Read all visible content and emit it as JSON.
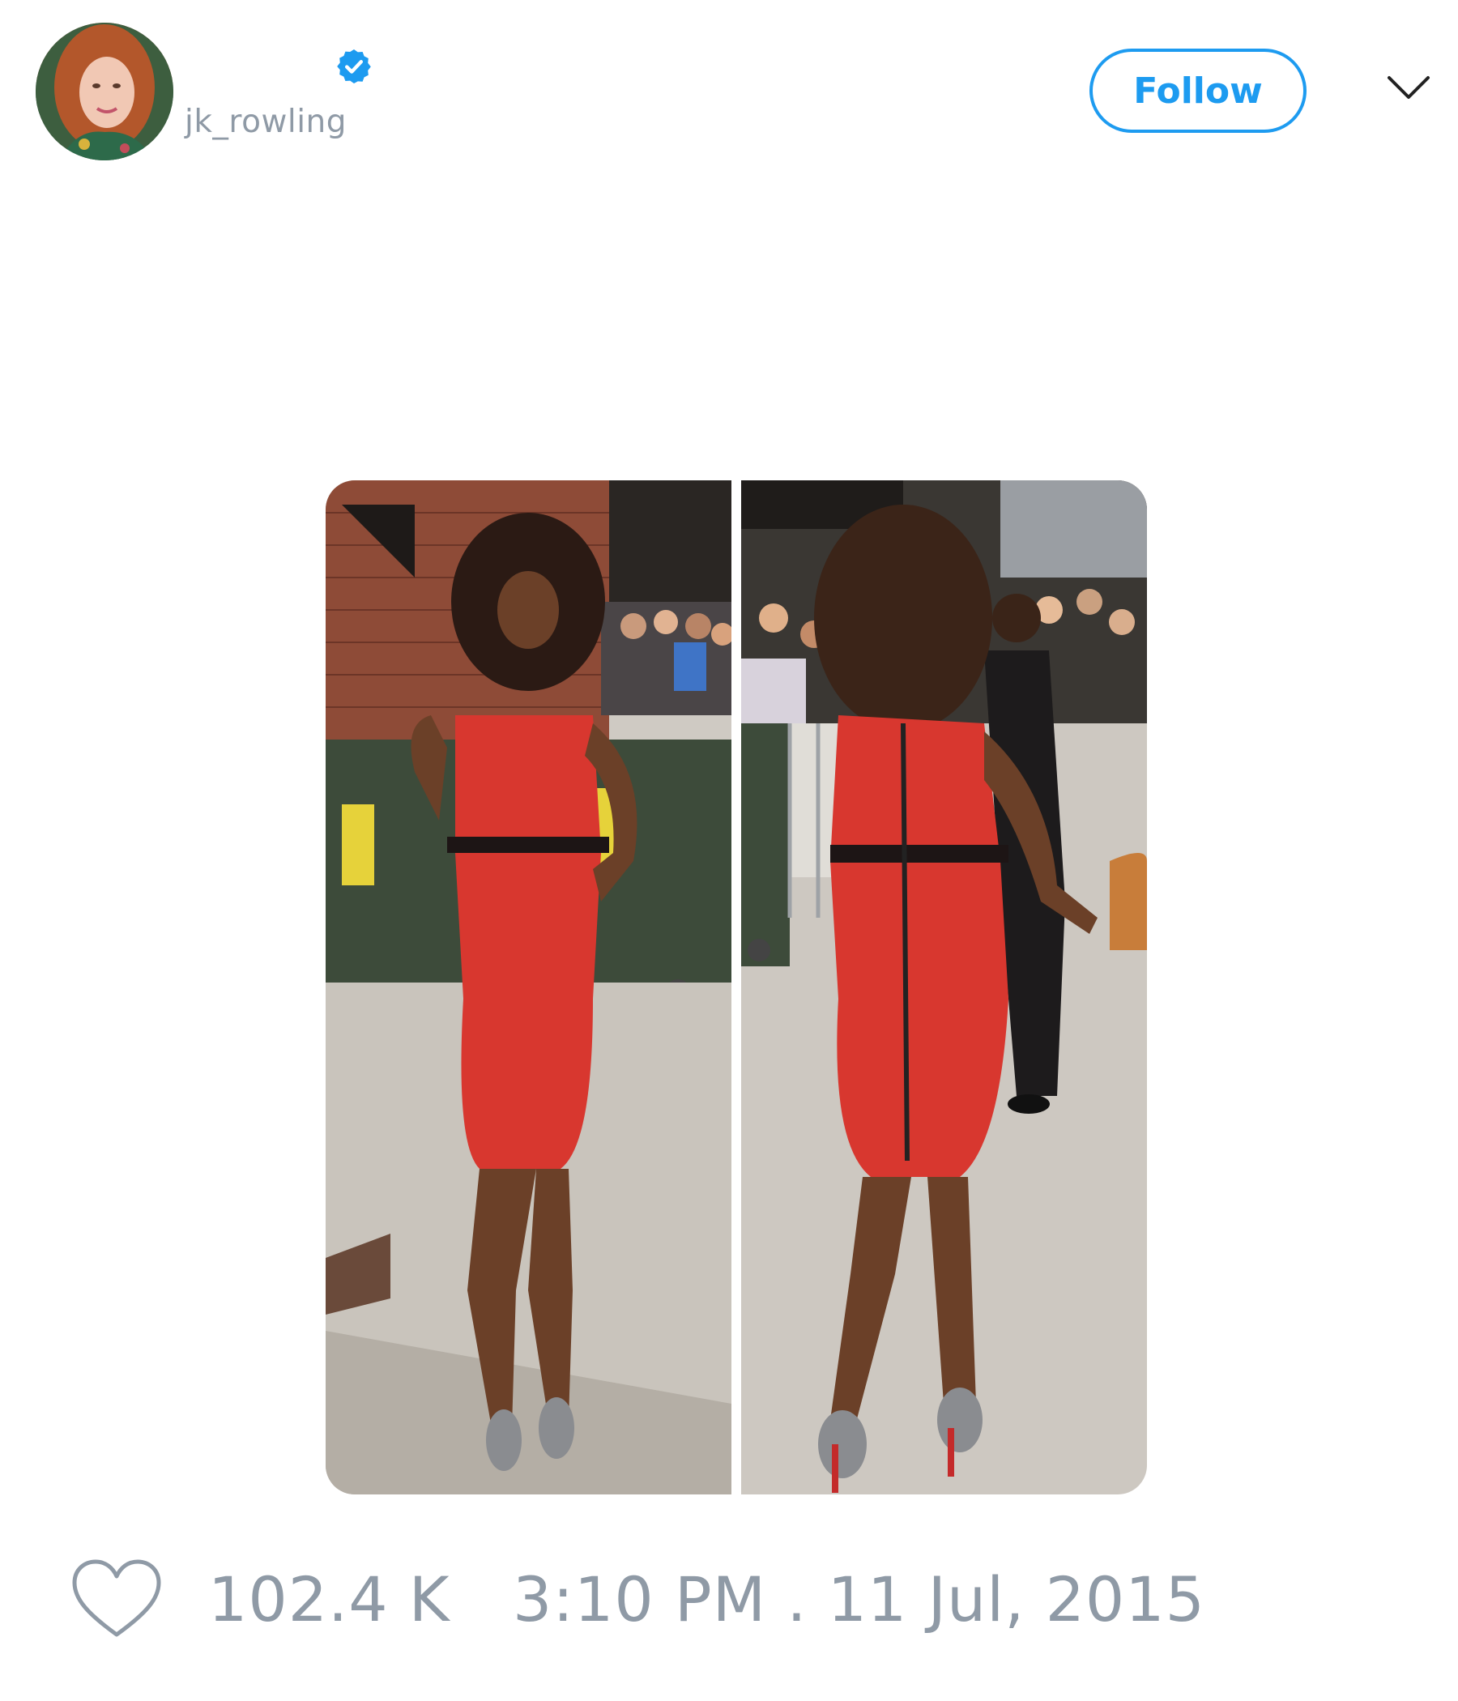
{
  "author": {
    "username": "jk_rowling",
    "verified_icon": "verified-badge-icon",
    "accent_color": "#1d9bf0"
  },
  "header": {
    "follow_label": "Follow",
    "menu_icon": "chevron-down-icon"
  },
  "media": {
    "panels": [
      {
        "description_icon": "photo-front-view"
      },
      {
        "description_icon": "photo-back-view"
      }
    ]
  },
  "footer": {
    "like_icon": "heart-icon",
    "likes": "102.4 K",
    "timestamp": "3:10 PM . 11 Jul, 2015",
    "text_color": "#8f9aa6"
  }
}
